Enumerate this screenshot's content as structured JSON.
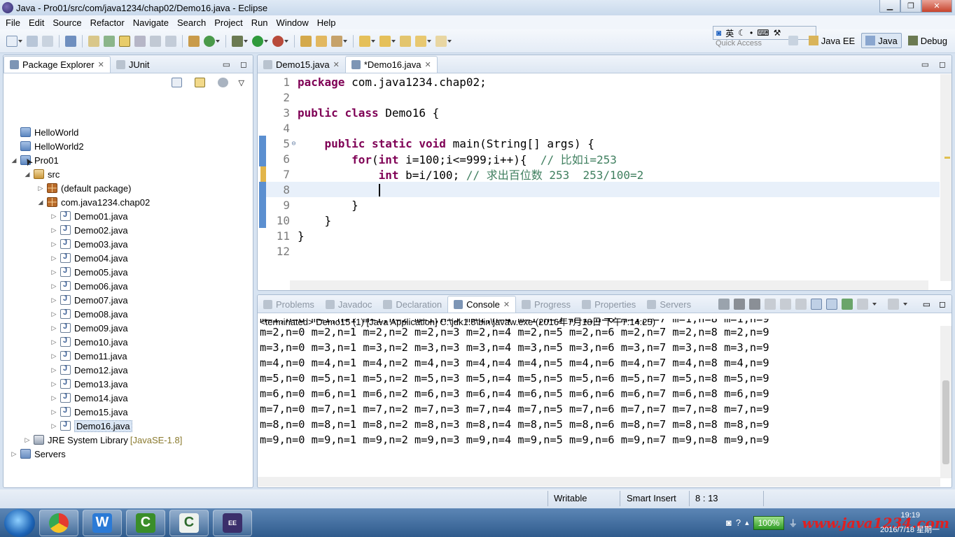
{
  "window": {
    "title": "Java - Pro01/src/com/java1234/chap02/Demo16.java - Eclipse"
  },
  "menu": [
    "File",
    "Edit",
    "Source",
    "Refactor",
    "Navigate",
    "Search",
    "Project",
    "Run",
    "Window",
    "Help"
  ],
  "ime": {
    "lang": "英"
  },
  "quick_access": {
    "placeholder": "Quick Access"
  },
  "perspectives": [
    {
      "label": "Java EE",
      "active": false
    },
    {
      "label": "Java",
      "active": true
    },
    {
      "label": "Debug",
      "active": false
    }
  ],
  "package_explorer": {
    "tabs": [
      {
        "label": "Package Explorer",
        "active": true
      },
      {
        "label": "JUnit",
        "active": false
      }
    ],
    "tree": [
      {
        "label": "HelloWorld",
        "icon": "project-icon",
        "depth": 0,
        "twisty": ""
      },
      {
        "label": "HelloWorld2",
        "icon": "project-icon",
        "depth": 0,
        "twisty": ""
      },
      {
        "label": "Pro01",
        "icon": "project-icon",
        "depth": 0,
        "twisty": "expanded"
      },
      {
        "label": "src",
        "icon": "source-folder-icon",
        "depth": 1,
        "twisty": "expanded"
      },
      {
        "label": "(default package)",
        "icon": "package-icon",
        "depth": 2,
        "twisty": "collapsed"
      },
      {
        "label": "com.java1234.chap02",
        "icon": "package-icon",
        "depth": 2,
        "twisty": "expanded"
      },
      {
        "label": "Demo01.java",
        "icon": "java-file-icon",
        "depth": 3,
        "twisty": "collapsed"
      },
      {
        "label": "Demo02.java",
        "icon": "java-file-icon",
        "depth": 3,
        "twisty": "collapsed"
      },
      {
        "label": "Demo03.java",
        "icon": "java-file-icon",
        "depth": 3,
        "twisty": "collapsed"
      },
      {
        "label": "Demo04.java",
        "icon": "java-file-icon",
        "depth": 3,
        "twisty": "collapsed"
      },
      {
        "label": "Demo05.java",
        "icon": "java-file-icon",
        "depth": 3,
        "twisty": "collapsed"
      },
      {
        "label": "Demo06.java",
        "icon": "java-file-icon",
        "depth": 3,
        "twisty": "collapsed"
      },
      {
        "label": "Demo07.java",
        "icon": "java-file-icon",
        "depth": 3,
        "twisty": "collapsed"
      },
      {
        "label": "Demo08.java",
        "icon": "java-file-icon",
        "depth": 3,
        "twisty": "collapsed"
      },
      {
        "label": "Demo09.java",
        "icon": "java-file-icon",
        "depth": 3,
        "twisty": "collapsed"
      },
      {
        "label": "Demo10.java",
        "icon": "java-file-icon",
        "depth": 3,
        "twisty": "collapsed"
      },
      {
        "label": "Demo11.java",
        "icon": "java-file-icon",
        "depth": 3,
        "twisty": "collapsed"
      },
      {
        "label": "Demo12.java",
        "icon": "java-file-icon",
        "depth": 3,
        "twisty": "collapsed"
      },
      {
        "label": "Demo13.java",
        "icon": "java-file-icon",
        "depth": 3,
        "twisty": "collapsed"
      },
      {
        "label": "Demo14.java",
        "icon": "java-file-icon",
        "depth": 3,
        "twisty": "collapsed"
      },
      {
        "label": "Demo15.java",
        "icon": "java-file-icon",
        "depth": 3,
        "twisty": "collapsed"
      },
      {
        "label": "Demo16.java",
        "icon": "java-file-icon",
        "depth": 3,
        "twisty": "collapsed",
        "selected": true
      },
      {
        "label": "JRE System Library",
        "version": "[JavaSE-1.8]",
        "icon": "library-icon",
        "depth": 1,
        "twisty": "collapsed"
      },
      {
        "label": "Servers",
        "icon": "folder-icon",
        "depth": 0,
        "twisty": "collapsed"
      }
    ]
  },
  "editor": {
    "tabs": [
      {
        "label": "Demo15.java",
        "active": false
      },
      {
        "label": "*Demo16.java",
        "active": true
      }
    ],
    "lines": [
      {
        "n": "1",
        "tokens": [
          {
            "t": "package",
            "c": "kw"
          },
          {
            "t": " com.java1234.chap02;"
          }
        ]
      },
      {
        "n": "2",
        "tokens": []
      },
      {
        "n": "3",
        "tokens": [
          {
            "t": "public",
            "c": "kw"
          },
          {
            "t": " "
          },
          {
            "t": "class",
            "c": "kw"
          },
          {
            "t": " Demo16 {"
          }
        ]
      },
      {
        "n": "4",
        "tokens": []
      },
      {
        "n": "5",
        "fold": "⊖",
        "tokens": [
          {
            "t": "    "
          },
          {
            "t": "public",
            "c": "kw"
          },
          {
            "t": " "
          },
          {
            "t": "static",
            "c": "kw"
          },
          {
            "t": " "
          },
          {
            "t": "void",
            "c": "kw"
          },
          {
            "t": " main(String[] args) {"
          }
        ]
      },
      {
        "n": "6",
        "tokens": [
          {
            "t": "        "
          },
          {
            "t": "for",
            "c": "kw"
          },
          {
            "t": "("
          },
          {
            "t": "int",
            "c": "kw"
          },
          {
            "t": " i=100;i<=999;i++){  "
          },
          {
            "t": "// 比如i=253",
            "c": "cm"
          }
        ]
      },
      {
        "n": "7",
        "tokens": [
          {
            "t": "            "
          },
          {
            "t": "int",
            "c": "kw"
          },
          {
            "t": " b=i/100; "
          },
          {
            "t": "// 求出百位数 253  253/100=2",
            "c": "cm"
          }
        ]
      },
      {
        "n": "8",
        "current": true,
        "tokens": [
          {
            "t": "            "
          }
        ]
      },
      {
        "n": "9",
        "tokens": [
          {
            "t": "        }"
          }
        ]
      },
      {
        "n": "10",
        "tokens": [
          {
            "t": "    }"
          }
        ]
      },
      {
        "n": "11",
        "tokens": [
          {
            "t": "}"
          }
        ]
      },
      {
        "n": "12",
        "tokens": []
      }
    ]
  },
  "console": {
    "tabs": [
      {
        "label": "Problems",
        "active": false
      },
      {
        "label": "Javadoc",
        "active": false
      },
      {
        "label": "Declaration",
        "active": false
      },
      {
        "label": "Console",
        "active": true
      },
      {
        "label": "Progress",
        "active": false
      },
      {
        "label": "Properties",
        "active": false
      },
      {
        "label": "Servers",
        "active": false
      }
    ],
    "terminated": "<terminated> Demo15 (1) [Java Application] C:\\jdk1.8\\bin\\javaw.exe (2016年7月18日 下午7:14:25)",
    "output": [
      "m=1,n=0 m=1,n=1 m=1,n=2 m=1,n=3 m=1,n=4 m=1,n=5 m=1,n=6 m=1,n=7 m=1,n=8 m=1,n=9",
      "m=2,n=0 m=2,n=1 m=2,n=2 m=2,n=3 m=2,n=4 m=2,n=5 m=2,n=6 m=2,n=7 m=2,n=8 m=2,n=9",
      "m=3,n=0 m=3,n=1 m=3,n=2 m=3,n=3 m=3,n=4 m=3,n=5 m=3,n=6 m=3,n=7 m=3,n=8 m=3,n=9",
      "m=4,n=0 m=4,n=1 m=4,n=2 m=4,n=3 m=4,n=4 m=4,n=5 m=4,n=6 m=4,n=7 m=4,n=8 m=4,n=9",
      "m=5,n=0 m=5,n=1 m=5,n=2 m=5,n=3 m=5,n=4 m=5,n=5 m=5,n=6 m=5,n=7 m=5,n=8 m=5,n=9",
      "m=6,n=0 m=6,n=1 m=6,n=2 m=6,n=3 m=6,n=4 m=6,n=5 m=6,n=6 m=6,n=7 m=6,n=8 m=6,n=9",
      "m=7,n=0 m=7,n=1 m=7,n=2 m=7,n=3 m=7,n=4 m=7,n=5 m=7,n=6 m=7,n=7 m=7,n=8 m=7,n=9",
      "m=8,n=0 m=8,n=1 m=8,n=2 m=8,n=3 m=8,n=4 m=8,n=5 m=8,n=6 m=8,n=7 m=8,n=8 m=8,n=9",
      "m=9,n=0 m=9,n=1 m=9,n=2 m=9,n=3 m=9,n=4 m=9,n=5 m=9,n=6 m=9,n=7 m=9,n=8 m=9,n=9"
    ]
  },
  "status": {
    "mode": "Writable",
    "insert": "Smart Insert",
    "position": "8 : 13"
  },
  "taskbar": {
    "battery": "100%",
    "watermark": "www.java1234.com",
    "clock_time": "19:19",
    "clock_date": "2016/7/18 星期一"
  },
  "colors": {
    "keyword": "#7f0055",
    "comment": "#3f7f5f",
    "current_line": "#e8f0fa",
    "change_ruler": "#5b8fd0"
  }
}
